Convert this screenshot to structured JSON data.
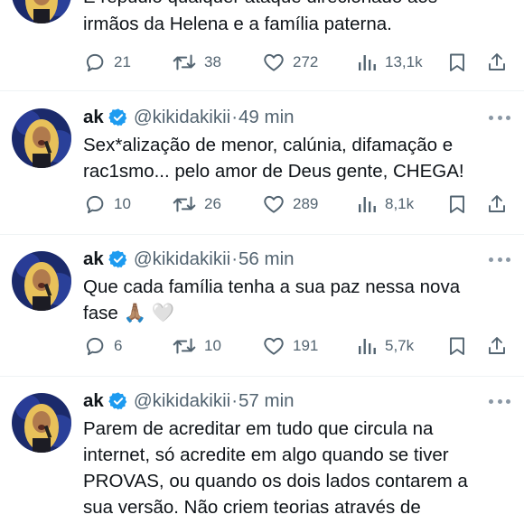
{
  "top": {
    "text_line1": "E repúdio qualquer ataque direcionado aos",
    "text_line2": "irmãos da Helena e a família paterna.",
    "replies": "21",
    "retweets": "38",
    "likes": "272",
    "views": "13,1k"
  },
  "tweets": [
    {
      "name": "ak",
      "handle": "@kikidakikii",
      "dot": "·",
      "time": "49 min",
      "line1": "Sex*alização de menor, calúnia, difamação e",
      "line2": "rac1smo... pelo amor de Deus gente, CHEGA!",
      "replies": "10",
      "retweets": "26",
      "likes": "289",
      "views": "8,1k"
    },
    {
      "name": "ak",
      "handle": "@kikidakikii",
      "dot": "·",
      "time": "56 min",
      "line1": "Que cada família tenha a sua paz nessa nova",
      "line2": "fase 🙏🏽 🤍",
      "replies": "6",
      "retweets": "10",
      "likes": "191",
      "views": "5,7k"
    },
    {
      "name": "ak",
      "handle": "@kikidakikii",
      "dot": "·",
      "time": "57 min",
      "line1": "Parem de acreditar em tudo que circula na",
      "line2": "internet, só acredite em algo quando se tiver",
      "line3": "PROVAS, ou quando os dois lados contarem a",
      "line4": "sua versão. Não criem teorias através de"
    }
  ],
  "icons": {
    "reply": "reply-icon",
    "retweet": "retweet-icon",
    "like": "heart-icon",
    "views": "views-icon",
    "bookmark": "bookmark-icon",
    "share": "share-icon",
    "verified": "verified-badge-icon",
    "more": "more-icon"
  },
  "colors": {
    "text": "#0f1419",
    "secondary": "#536471",
    "verified": "#1d9bf0",
    "divider": "#eff3f4"
  }
}
